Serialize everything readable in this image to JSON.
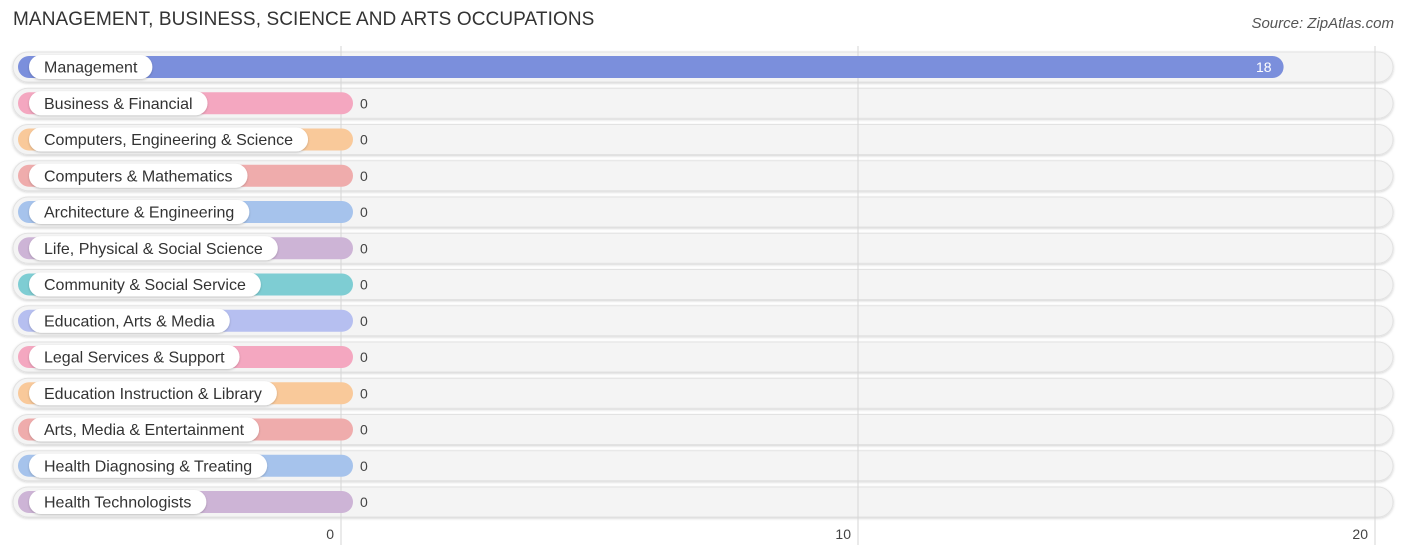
{
  "header": {
    "title": "MANAGEMENT, BUSINESS, SCIENCE AND ARTS OCCUPATIONS",
    "source": "Source: ZipAtlas.com"
  },
  "chart_data": {
    "type": "bar",
    "orientation": "horizontal",
    "title": "MANAGEMENT, BUSINESS, SCIENCE AND ARTS OCCUPATIONS",
    "xlabel": "",
    "ylabel": "",
    "xlim": [
      0,
      20
    ],
    "xticks": [
      0,
      10,
      20
    ],
    "xtick_labels": [
      "0",
      "10",
      "20"
    ],
    "grid": true,
    "legend": "none",
    "categories": [
      "Management",
      "Business & Financial",
      "Computers, Engineering & Science",
      "Computers & Mathematics",
      "Architecture & Engineering",
      "Life, Physical & Social Science",
      "Community & Social Service",
      "Education, Arts & Media",
      "Legal Services & Support",
      "Education Instruction & Library",
      "Arts, Media & Entertainment",
      "Health Diagnosing & Treating",
      "Health Technologists"
    ],
    "values": [
      18,
      0,
      0,
      0,
      0,
      0,
      0,
      0,
      0,
      0,
      0,
      0,
      0
    ],
    "value_labels": [
      "18",
      "0",
      "0",
      "0",
      "0",
      "0",
      "0",
      "0",
      "0",
      "0",
      "0",
      "0",
      "0"
    ],
    "colors": [
      "#7b8fdc",
      "#f4a7c0",
      "#f9c99a",
      "#efacac",
      "#a6c3ec",
      "#cdb4d6",
      "#7ecdd3",
      "#b6bff0",
      "#f4a7c0",
      "#f9c99a",
      "#efacac",
      "#a6c3ec",
      "#cdb4d6"
    ]
  }
}
